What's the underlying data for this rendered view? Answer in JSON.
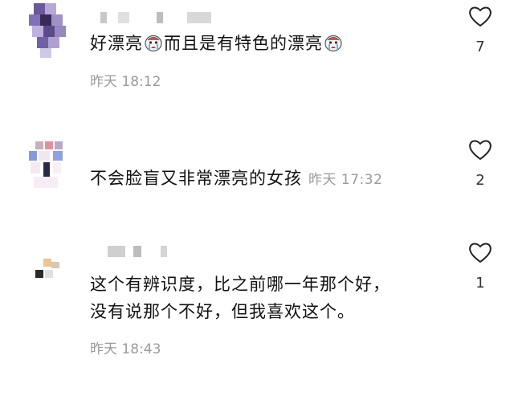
{
  "comments": [
    {
      "text_before": "好漂亮",
      "text_middle": "而且是有特色的漂亮",
      "time": "昨天 18:12",
      "likes": "7"
    },
    {
      "text": "不会脸盲又非常漂亮的女孩",
      "time": "昨天 17:32",
      "likes": "2"
    },
    {
      "line1": "这个有辨识度，比之前哪一年那个好，",
      "line2": "没有说那个不好，但我喜欢这个。",
      "time": "昨天 18:43",
      "likes": "1"
    }
  ],
  "icons": {
    "like": "heart-outline-icon",
    "emoji": "crying-face-emoji"
  },
  "colors": {
    "text": "#111111",
    "meta": "#9a9a9a",
    "count": "#333333"
  }
}
